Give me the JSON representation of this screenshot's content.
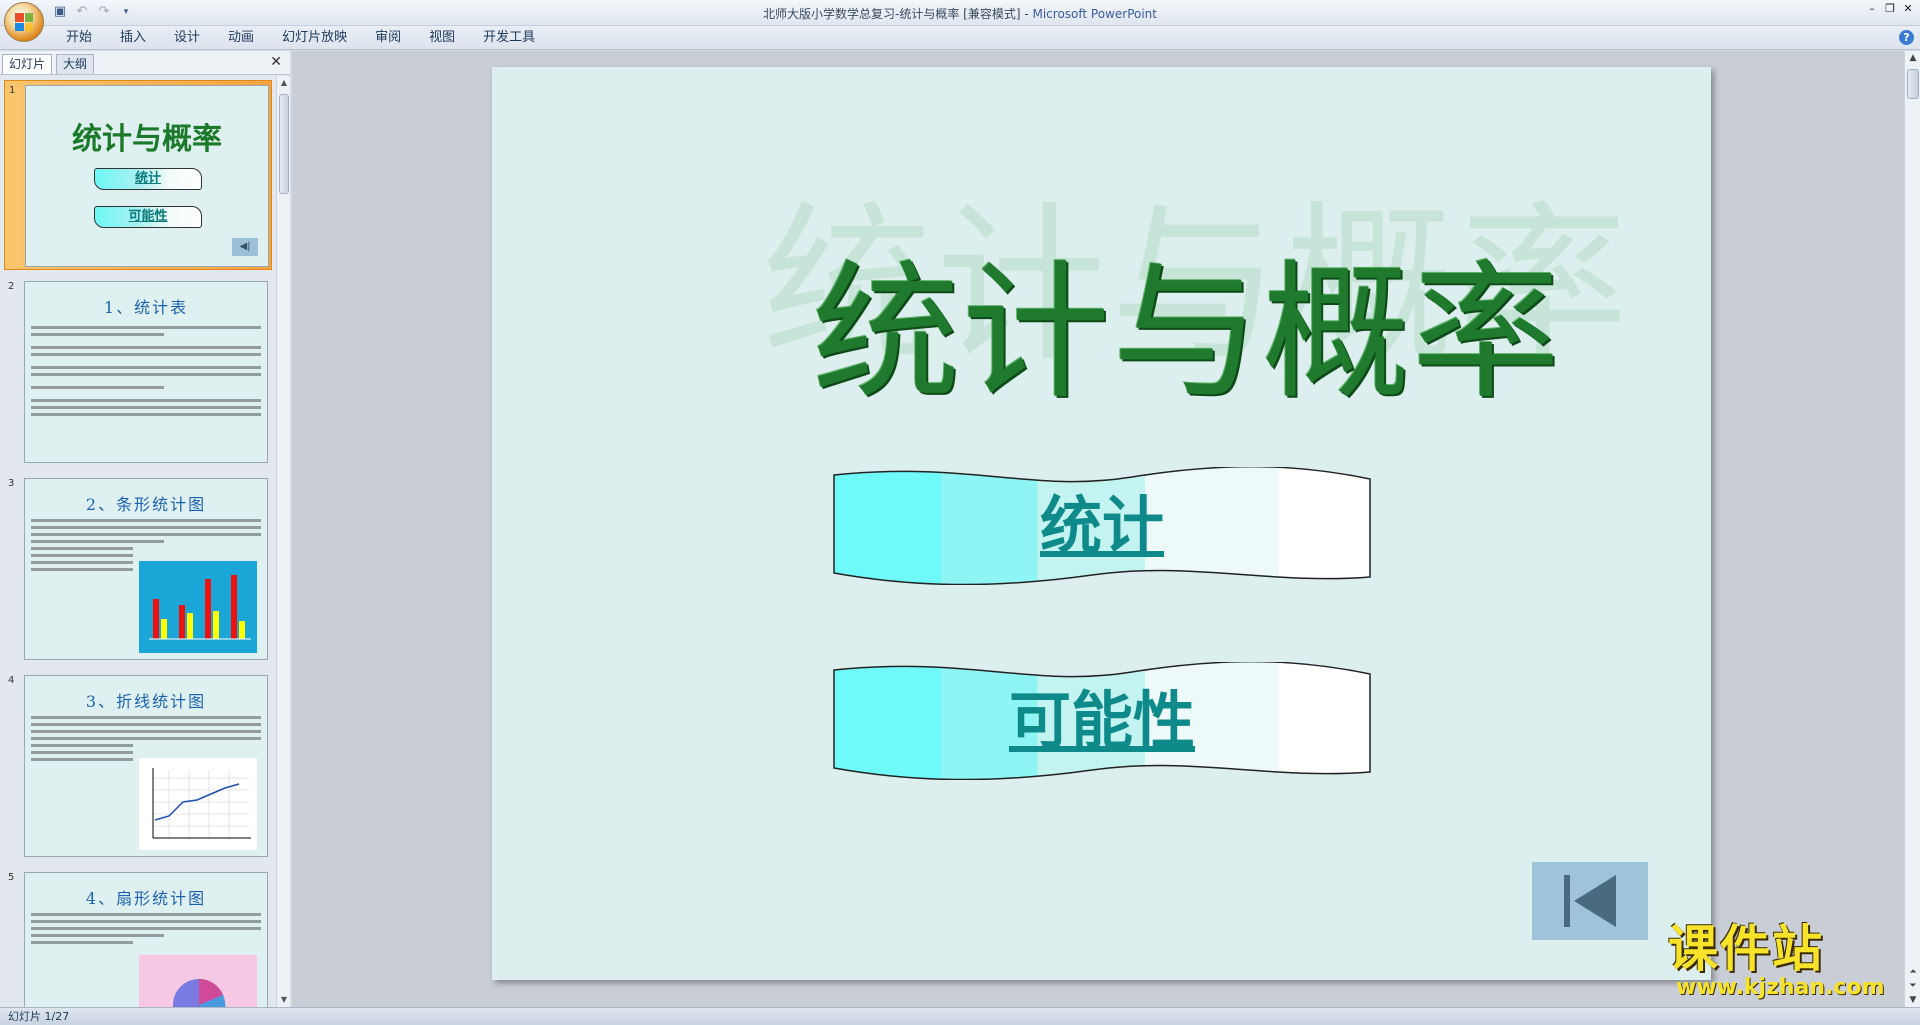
{
  "window": {
    "title": "北师大版小学数学总复习-统计与概率 [兼容模式]",
    "app_name": "Microsoft PowerPoint",
    "title_separator": " - "
  },
  "ribbon": {
    "tabs": [
      "开始",
      "插入",
      "设计",
      "动画",
      "幻灯片放映",
      "审阅",
      "视图",
      "开发工具"
    ]
  },
  "left_pane": {
    "tabs": [
      "幻灯片",
      "大纲"
    ],
    "slides": [
      {
        "number": "1",
        "title": "统计与概率",
        "buttons": [
          "统计",
          "可能性"
        ]
      },
      {
        "number": "2",
        "title": "1、统计表"
      },
      {
        "number": "3",
        "title": "2、条形统计图"
      },
      {
        "number": "4",
        "title": "3、折线统计图"
      },
      {
        "number": "5",
        "title": "4、扇形统计图"
      }
    ]
  },
  "slide": {
    "title": "统计与概率",
    "buttons": [
      "统计",
      "可能性"
    ]
  },
  "status": {
    "text": "幻灯片 1/27"
  },
  "watermark": {
    "name": "课件站",
    "url": "www.kjzhan.com"
  },
  "colors": {
    "title_green": "#1f7a2e",
    "slide_bg": "#dcefee",
    "banner_cyan": "#6ff7f7",
    "link_teal": "#0f8a8a",
    "selected_orange": "#f5a43c"
  }
}
